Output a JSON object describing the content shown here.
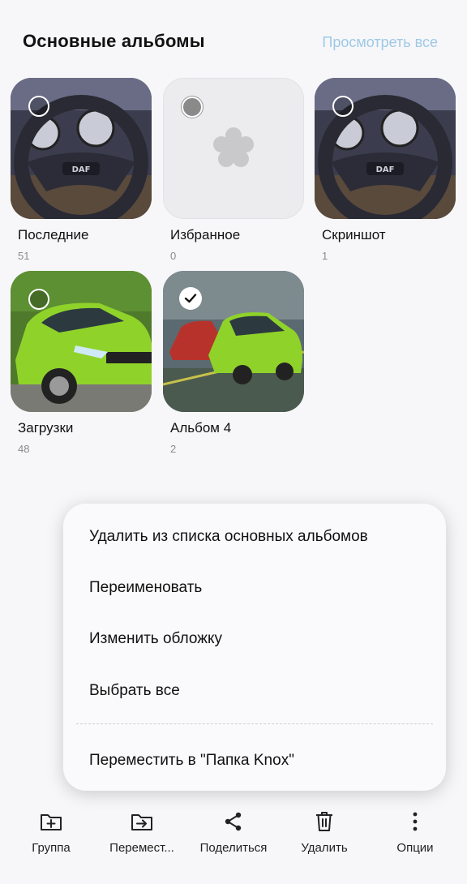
{
  "header": {
    "title": "Основные альбомы",
    "view_all": "Просмотреть все"
  },
  "albums": [
    {
      "name": "Последние",
      "count": "51"
    },
    {
      "name": "Избранное",
      "count": "0"
    },
    {
      "name": "Скриншот",
      "count": "1"
    },
    {
      "name": "Загрузки",
      "count": "48"
    },
    {
      "name": "Альбом 4",
      "count": "2"
    }
  ],
  "context_menu": {
    "items": [
      "Удалить из списка основных альбомов",
      "Переименовать",
      "Изменить обложку",
      "Выбрать все",
      "Переместить в \"Папка Knox\""
    ]
  },
  "toolbar": {
    "group": "Группа",
    "move": "Перемест...",
    "share": "Поделиться",
    "delete": "Удалить",
    "options": "Опции"
  },
  "colors": {
    "accent_link": "#9ec9e6",
    "car_green": "#8fd22a"
  },
  "icons": [
    "steering-wheel-thumbnail",
    "flower-icon",
    "car-thumbnail",
    "checkmark-icon",
    "add-folder-icon",
    "move-folder-icon",
    "share-icon",
    "trash-icon",
    "more-vertical-icon"
  ]
}
